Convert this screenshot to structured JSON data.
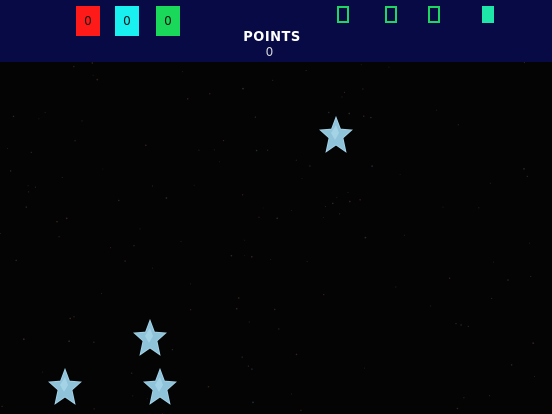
{
  "hud": {
    "counters": [
      {
        "value": "0",
        "color": "#ff1a1a"
      },
      {
        "value": "0",
        "color": "#19f0f0"
      },
      {
        "value": "0",
        "color": "#19d85a"
      }
    ],
    "points_label": "POINTS",
    "points_value": "0",
    "slots": [
      {
        "state": "empty"
      },
      {
        "state": "empty"
      },
      {
        "state": "empty"
      },
      {
        "state": "filled"
      }
    ],
    "colors": {
      "background": "#070a44",
      "slot_border": "#1ed760",
      "slot_fill": "#1ee6a8"
    }
  },
  "playfield": {
    "background": "#040404",
    "star_color": "#8fc3da",
    "star_icon": "star-icon",
    "star_count": 4
  }
}
